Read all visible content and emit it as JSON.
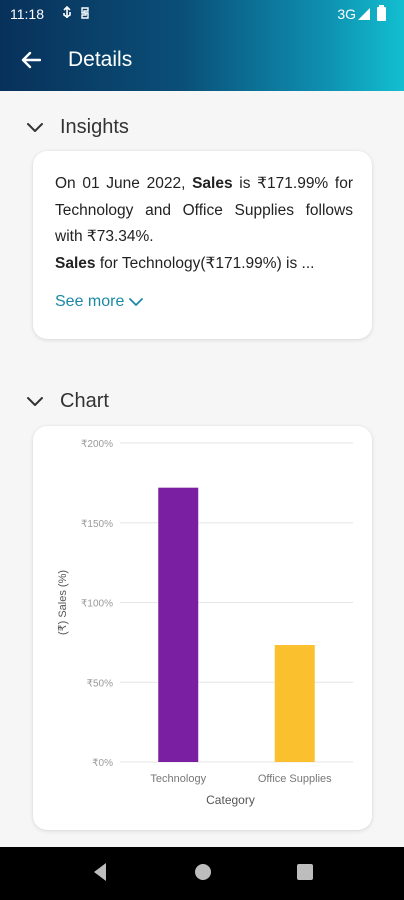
{
  "status_bar": {
    "time": "11:18",
    "network": "3G"
  },
  "app_bar": {
    "title": "Details",
    "back_icon": "arrow-left-icon"
  },
  "insights": {
    "section_label": "Insights",
    "text_line1_pre": "On 01 June 2022, ",
    "text_line1_bold": "Sales",
    "text_line1_post": " is ₹171.99% for Technology and Office Supplies follows with ₹73.34%.",
    "text_line2_bold": "Sales",
    "text_line2_post": " for Technology(₹171.99%) is ...",
    "see_more_label": "See more"
  },
  "chart_section": {
    "section_label": "Chart"
  },
  "chart_data": {
    "type": "bar",
    "categories": [
      "Technology",
      "Office Supplies"
    ],
    "values": [
      171.99,
      73.34
    ],
    "colors": [
      "#7b1fa2",
      "#fbc02d"
    ],
    "xlabel": "Category",
    "ylabel": "(₹) Sales (%)",
    "ylim": [
      0,
      200
    ],
    "yticks": [
      0,
      50,
      100,
      150,
      200
    ],
    "ytick_labels": [
      "₹0%",
      "₹50%",
      "₹100%",
      "₹150%",
      "₹200%"
    ],
    "grid": true
  },
  "colors": {
    "accent": "#1a8aa3",
    "header_start": "#08315a",
    "header_end": "#12bfd0"
  }
}
